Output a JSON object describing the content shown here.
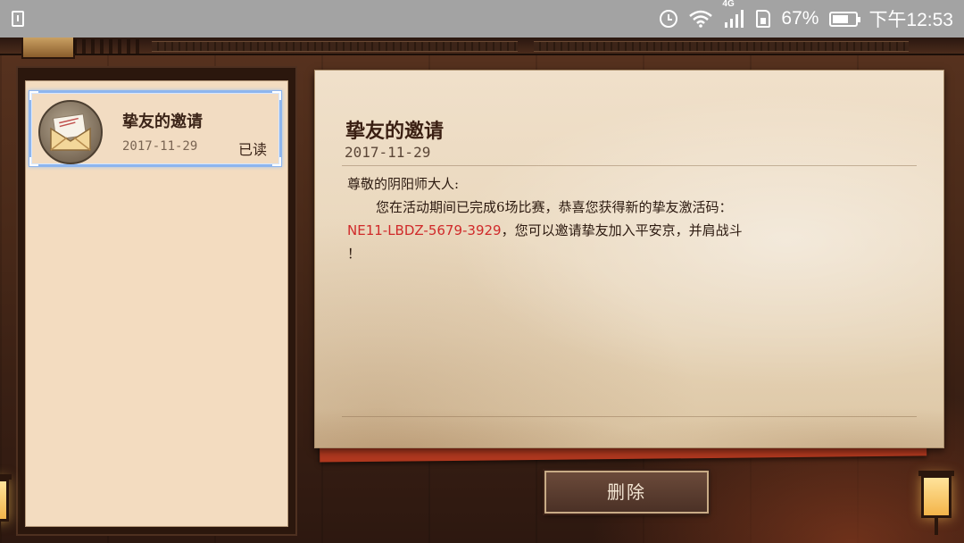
{
  "status_bar": {
    "network_type": "4G",
    "battery_percent": "67%",
    "battery_level": 0.67,
    "time": "下午12:53",
    "icons": [
      "notification-icon",
      "alarm-icon",
      "wifi-icon",
      "signal-icon",
      "sim-icon",
      "battery-icon"
    ]
  },
  "mail_list": {
    "items": [
      {
        "title": "挚友的邀请",
        "date": "2017-11-29",
        "status": "已读",
        "icon": "envelope-icon",
        "selected": true
      }
    ]
  },
  "letter": {
    "title": "挚友的邀请",
    "date": "2017-11-29",
    "greeting": "尊敬的阴阳师大人:",
    "line1": "您在活动期间已完成6场比赛，恭喜您获得新的挚友激活码：",
    "code": "NE11-LBDZ-5679-3929",
    "line2_rest": "，您可以邀请挚友加入平安京，并肩战斗",
    "line3": "！"
  },
  "actions": {
    "delete_label": "删除"
  },
  "colors": {
    "selection_border": "#8db5ee",
    "code_red": "#d02a2a",
    "paper": "#f0e0ca",
    "status_bar": "#a3a3a3"
  }
}
